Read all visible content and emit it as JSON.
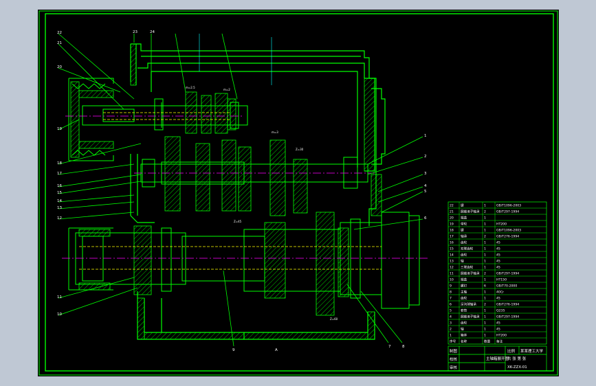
{
  "title_block": {
    "drawing_title": "主轴箱展开图",
    "school": "某某理工大学",
    "drawing_no": "XK-ZZX-01",
    "label_rows": [
      "制图",
      "校核",
      "审核"
    ],
    "scale_label": "比例",
    "sheet_label": "共 张 第 张"
  },
  "parts_list": {
    "rows": [
      {
        "no": "22",
        "name": "键",
        "qty": "1",
        "spec": "GB/T1096-2003"
      },
      {
        "no": "21",
        "name": "圆锥滚子轴承",
        "qty": "2",
        "spec": "GB/T297-1994"
      },
      {
        "no": "20",
        "name": "端盖",
        "qty": "1",
        "spec": ""
      },
      {
        "no": "19",
        "name": "带轮",
        "qty": "1",
        "spec": "HT200"
      },
      {
        "no": "18",
        "name": "键",
        "qty": "1",
        "spec": "GB/T1096-2003"
      },
      {
        "no": "17",
        "name": "轴承",
        "qty": "2",
        "spec": "GB/T276-1994"
      },
      {
        "no": "16",
        "name": "齿轮",
        "qty": "1",
        "spec": "45"
      },
      {
        "no": "15",
        "name": "双联齿轮",
        "qty": "1",
        "spec": "45"
      },
      {
        "no": "14",
        "name": "齿轮",
        "qty": "1",
        "spec": "45"
      },
      {
        "no": "13",
        "name": "轴",
        "qty": "1",
        "spec": "45"
      },
      {
        "no": "12",
        "name": "三联齿轮",
        "qty": "1",
        "spec": "45"
      },
      {
        "no": "11",
        "name": "圆锥滚子轴承",
        "qty": "2",
        "spec": "GB/T297-1994"
      },
      {
        "no": "10",
        "name": "端盖",
        "qty": "1",
        "spec": "HT150"
      },
      {
        "no": "9",
        "name": "螺钉",
        "qty": "6",
        "spec": "GB/T70-2000"
      },
      {
        "no": "8",
        "name": "主轴",
        "qty": "1",
        "spec": "40Cr"
      },
      {
        "no": "7",
        "name": "齿轮",
        "qty": "1",
        "spec": "45"
      },
      {
        "no": "6",
        "name": "深沟球轴承",
        "qty": "2",
        "spec": "GB/T276-1994"
      },
      {
        "no": "5",
        "name": "套筒",
        "qty": "1",
        "spec": "Q235"
      },
      {
        "no": "4",
        "name": "圆锥滚子轴承",
        "qty": "1",
        "spec": "GB/T297-1994"
      },
      {
        "no": "3",
        "name": "齿轮",
        "qty": "1",
        "spec": "45"
      },
      {
        "no": "2",
        "name": "轴",
        "qty": "1",
        "spec": "45"
      },
      {
        "no": "1",
        "name": "箱体",
        "qty": "1",
        "spec": "HT200"
      }
    ],
    "header": {
      "no": "序号",
      "name": "名称",
      "qty": "数量",
      "spec": "备注"
    }
  },
  "callouts": {
    "top": [
      "22",
      "21",
      "20",
      "19",
      "23",
      "24"
    ],
    "left": [
      "18",
      "17",
      "16",
      "15",
      "14",
      "13",
      "12",
      "11",
      "10"
    ],
    "right": [
      "1",
      "2",
      "3",
      "4",
      "5",
      "6",
      "7",
      "8"
    ],
    "bottom": [
      "9"
    ]
  },
  "gear_labels": [
    "m=2.5",
    "m=2",
    "m=3",
    "Z=30",
    "Z=45",
    "Z=60"
  ],
  "section_label": "A",
  "colors": {
    "outline": "#00ff00",
    "centerline": "#ff00ff",
    "dim": "#ffff00",
    "leader": "#00ff00",
    "text": "#ffffff",
    "hidden": "#00ffff"
  }
}
